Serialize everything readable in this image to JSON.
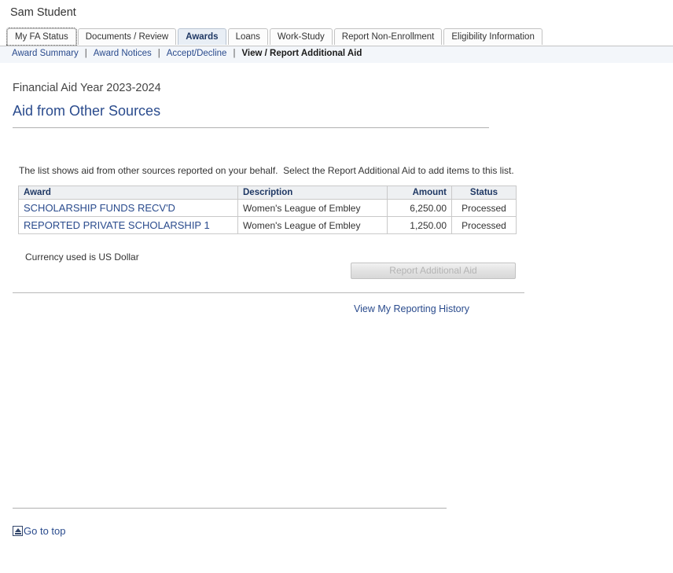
{
  "user": {
    "name": "Sam Student"
  },
  "tabs": [
    {
      "label": "My FA Status",
      "state": "focus"
    },
    {
      "label": "Documents / Review",
      "state": "normal"
    },
    {
      "label": "Awards",
      "state": "active"
    },
    {
      "label": "Loans",
      "state": "normal"
    },
    {
      "label": "Work-Study",
      "state": "normal"
    },
    {
      "label": "Report Non-Enrollment",
      "state": "normal"
    },
    {
      "label": "Eligibility Information",
      "state": "normal"
    }
  ],
  "subnav": {
    "items": [
      {
        "label": "Award Summary",
        "current": false
      },
      {
        "label": "Award Notices",
        "current": false
      },
      {
        "label": "Accept/Decline",
        "current": false
      },
      {
        "label": "View / Report Additional Aid",
        "current": true
      }
    ],
    "separator": "|"
  },
  "page": {
    "aid_year": "Financial Aid Year 2023-2024",
    "title": "Aid from Other Sources",
    "instruction": "The list shows aid from other sources reported on your behalf.  Select the Report Additional Aid to add items to this list.",
    "currency_note": "Currency used is US Dollar"
  },
  "table": {
    "headers": {
      "award": "Award",
      "description": "Description",
      "amount": "Amount",
      "status": "Status"
    },
    "rows": [
      {
        "award": "SCHOLARSHIP FUNDS RECV'D",
        "description": "Women's League of Embley",
        "amount": "6,250.00",
        "status": "Processed"
      },
      {
        "award": "REPORTED PRIVATE SCHOLARSHIP 1",
        "description": "Women's League of Embley",
        "amount": "1,250.00",
        "status": "Processed"
      }
    ]
  },
  "actions": {
    "report_additional_aid": "Report Additional Aid",
    "view_reporting_history": "View My Reporting History"
  },
  "footer": {
    "go_to_top": "Go to top"
  },
  "colors": {
    "link": "#2a4b8d",
    "title": "#2a4b8d",
    "header_text": "#1f3864",
    "active_tab_bg": "#e8eef5",
    "table_header_bg": "#eef0f2",
    "disabled_text": "#b4b4b4"
  }
}
